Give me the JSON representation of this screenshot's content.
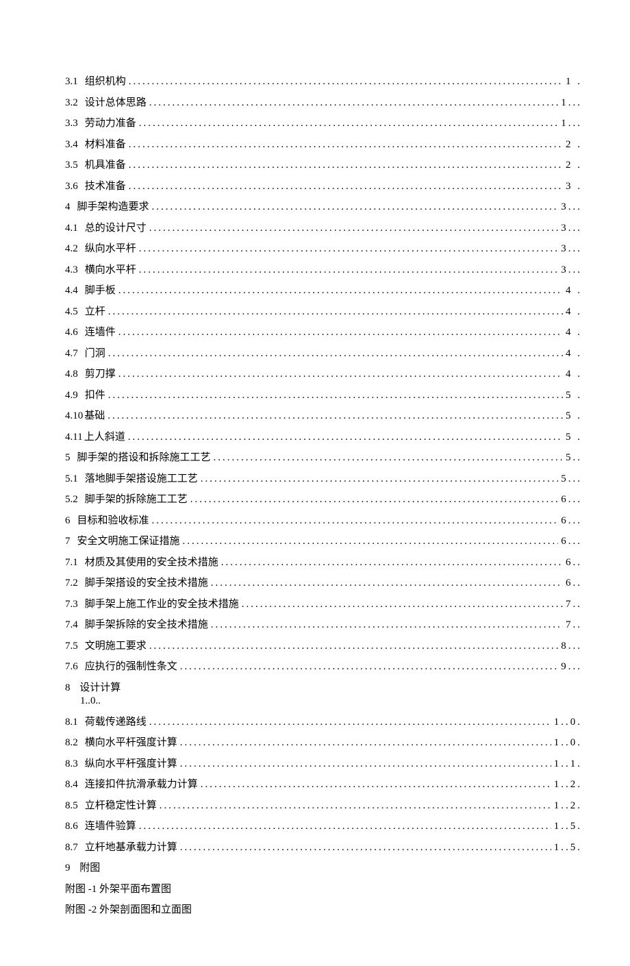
{
  "toc": [
    {
      "num": "3.1",
      "title": "组织机构",
      "page": "1 ."
    },
    {
      "num": "3.2",
      "title": "设计总体思路",
      "page": "1..."
    },
    {
      "num": "3.3",
      "title": "劳动力准备",
      "page": "1..."
    },
    {
      "num": "3.4",
      "title": "材料准备",
      "page": "2 ."
    },
    {
      "num": "3.5",
      "title": "机具准备",
      "page": "2 ."
    },
    {
      "num": "3.6",
      "title": "技术准备",
      "page": "3 ."
    },
    {
      "num": "4",
      "title": "脚手架构造要求",
      "page": "3..."
    },
    {
      "num": "4.1",
      "title": "总的设计尺寸",
      "page": "3..."
    },
    {
      "num": "4.2",
      "title": "纵向水平杆",
      "page": "3..."
    },
    {
      "num": "4.3",
      "title": "横向水平杆",
      "page": "3..."
    },
    {
      "num": "4.4",
      "title": "脚手板",
      "page": "4 ."
    },
    {
      "num": "4.5",
      "title": "立杆",
      "page": "4 ."
    },
    {
      "num": "4.6",
      "title": "连墙件",
      "page": "4 ."
    },
    {
      "num": "4.7",
      "title": "门洞",
      "page": "4 ."
    },
    {
      "num": "4.8",
      "title": "剪刀撑",
      "page": "4 ."
    },
    {
      "num": "4.9",
      "title": "扣件",
      "page": "5 ."
    },
    {
      "num": "4.10",
      "title": "基础",
      "page": "5 .",
      "nospace": true
    },
    {
      "num": "4.11",
      "title": "上人斜道",
      "page": "5 .",
      "nospace": true
    },
    {
      "num": "5",
      "title": "脚手架的搭设和拆除施工工艺",
      "page": "5.."
    },
    {
      "num": "5.1",
      "title": "落地脚手架搭设施工工艺",
      "page": "5..."
    },
    {
      "num": "5.2",
      "title": "脚手架的拆除施工工艺",
      "page": "6..."
    },
    {
      "num": "6",
      "title": "目标和验收标准",
      "page": "6..."
    },
    {
      "num": "7",
      "title": "安全文明施工保证措施",
      "page": "6..."
    },
    {
      "num": "7.1",
      "title": "材质及其使用的安全技术措施",
      "page": "6.."
    },
    {
      "num": "7.2",
      "title": "脚手架搭设的安全技术措施",
      "page": "6.."
    },
    {
      "num": "7.3",
      "title": "脚手架上施工作业的安全技术措施",
      "page": "7.."
    },
    {
      "num": "7.4",
      "title": "脚手架拆除的安全技术措施",
      "page": "7.."
    },
    {
      "num": "7.5",
      "title": "文明施工要求",
      "page": "8..."
    },
    {
      "num": "7.6",
      "title": "应执行的强制性条文",
      "page": "9..."
    }
  ],
  "section8": {
    "num": "8",
    "title": "设计计算",
    "sub": "1..0.."
  },
  "toc8": [
    {
      "num": "8.1",
      "title": "荷载传递路线",
      "page": "1..0."
    },
    {
      "num": "8.2",
      "title": "横向水平杆强度计算",
      "page": "1..0."
    },
    {
      "num": "8.3",
      "title": "纵向水平杆强度计算",
      "page": "1..1."
    },
    {
      "num": "8.4",
      "title": "连接扣件抗滑承载力计算",
      "page": "1..2."
    },
    {
      "num": "8.5",
      "title": "立杆稳定性计算",
      "page": "1..2."
    },
    {
      "num": "8.6",
      "title": "连墙件验算",
      "page": "1..5."
    },
    {
      "num": "8.7",
      "title": "立杆地基承载力计算",
      "page": "1..5."
    }
  ],
  "section9": {
    "num": "9",
    "title": "附图"
  },
  "appendix": [
    {
      "label": "附图 -1 外架平面布置图"
    },
    {
      "label": "附图 -2 外架剖面图和立面图"
    }
  ]
}
